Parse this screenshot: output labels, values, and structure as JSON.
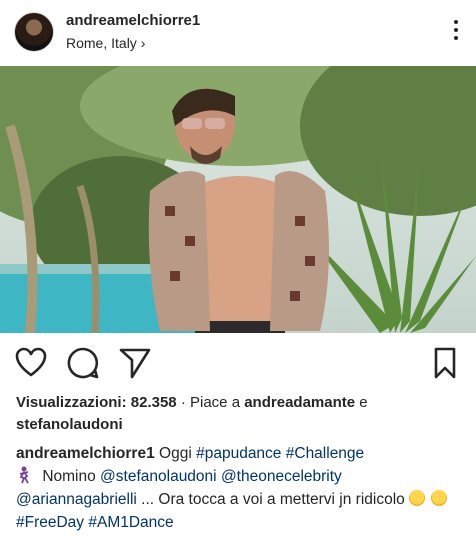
{
  "post": {
    "username": "andreamelchiorre1",
    "location": "Rome, Italy",
    "location_chevron": "›"
  },
  "icons": {
    "more": "more-options-icon",
    "like": "heart-icon",
    "comment": "comment-icon",
    "share": "send-icon",
    "save": "bookmark-icon"
  },
  "stats": {
    "views_label": "Visualizzazioni:",
    "views_count": "82.358",
    "separator": "·",
    "liked_by_prefix": "Piace a",
    "liked_by_user": "andreadamante",
    "liked_by_conj": "e",
    "liked_by_user2": "stefanolaudoni"
  },
  "caption": {
    "author": "andreamelchiorre1",
    "text1": "Oggi",
    "hashtag1": "#papudance",
    "hashtag2": "#Challenge",
    "text2": "Nomino",
    "mention1": "@stefanolaudoni",
    "mention2": "@theonecelebrity",
    "mention3": "@ariannagabrielli",
    "text3": "... Ora tocca a voi a mettervi jn ridicolo",
    "hashtag3": "#FreeDay",
    "hashtag4": "#AM1Dance"
  },
  "colors": {
    "link": "#003569",
    "text": "#262626"
  }
}
